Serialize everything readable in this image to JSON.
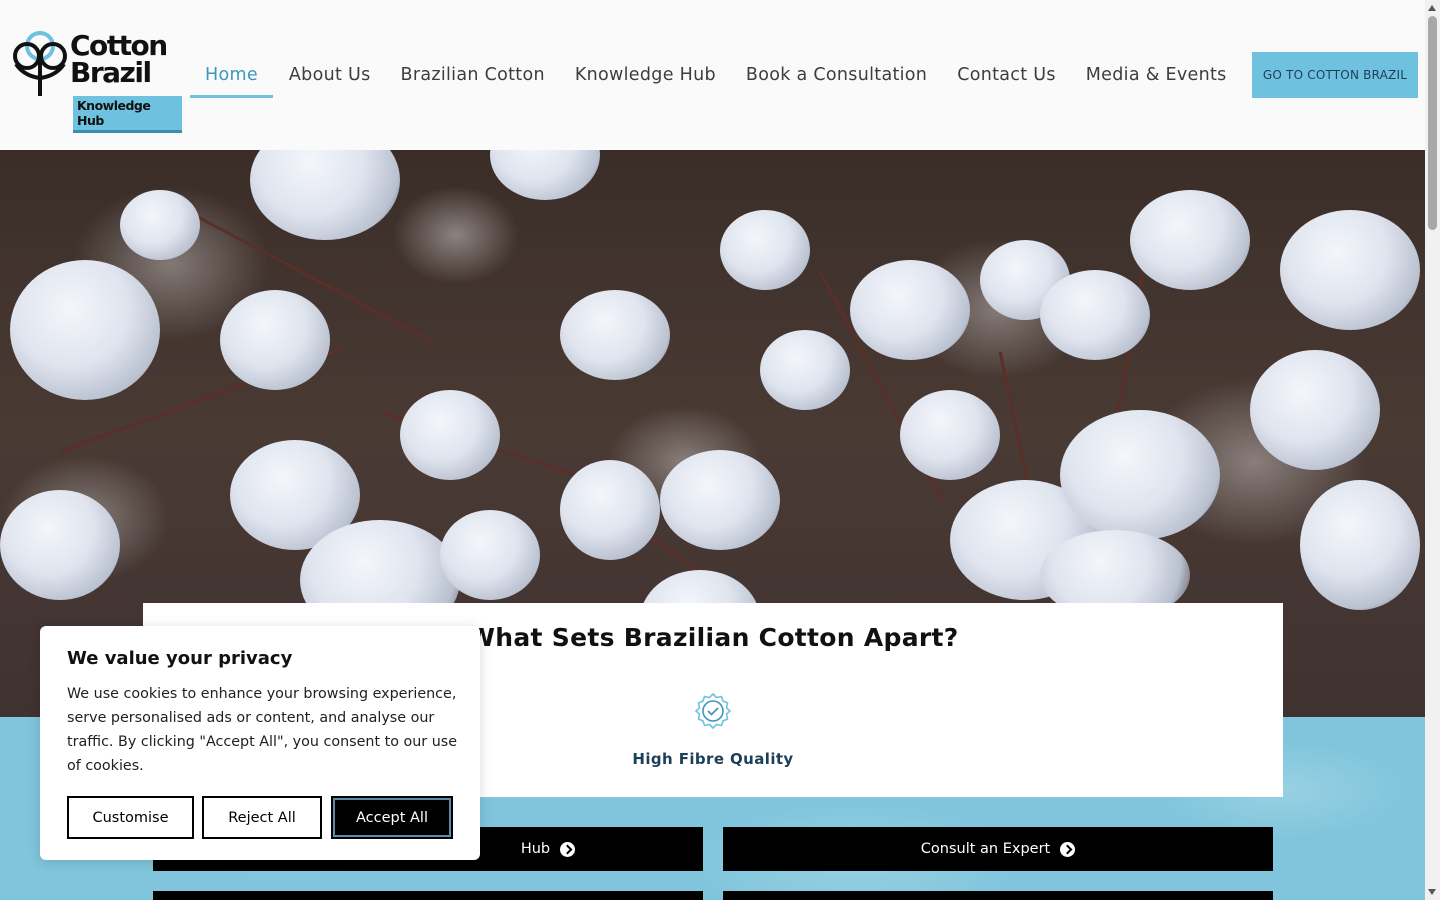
{
  "logo": {
    "line1": "Cotton",
    "line2": "Brazil",
    "badge": "Knowledge Hub"
  },
  "nav": {
    "items": [
      {
        "label": "Home",
        "active": true
      },
      {
        "label": "About Us"
      },
      {
        "label": "Brazilian Cotton"
      },
      {
        "label": "Knowledge Hub"
      },
      {
        "label": "Book a Consultation"
      },
      {
        "label": "Contact Us"
      },
      {
        "label": "Media & Events"
      }
    ],
    "cta": "GO TO COTTON BRAZIL"
  },
  "features": {
    "title": "What Sets Brazilian Cotton Apart?",
    "items": [
      {
        "label": "High Fibre Quality",
        "icon": "badge-check-icon"
      }
    ]
  },
  "actions": {
    "left_label": "Hub",
    "right_label": "Consult an Expert"
  },
  "cookie": {
    "title": "We value your privacy",
    "body": "We use cookies to enhance your browsing experience, serve personalised ads or content, and analyse our traffic. By clicking \"Accept All\", you consent to our use of cookies.",
    "customise": "Customise",
    "reject": "Reject All",
    "accept": "Accept All"
  },
  "colors": {
    "accent": "#6ec2e0",
    "accent_dark": "#3e95bd",
    "heading_blue": "#1b3f57"
  }
}
